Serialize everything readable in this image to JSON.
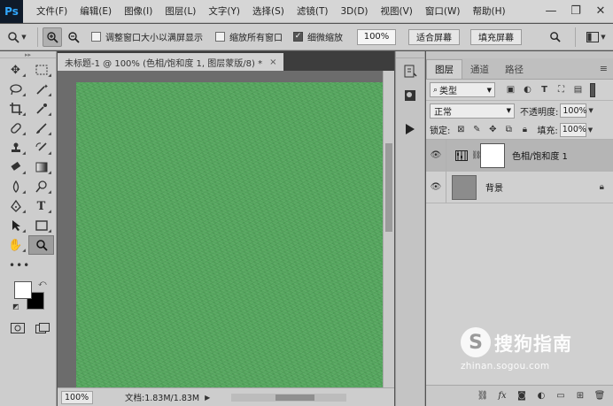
{
  "app": {
    "logo": "Ps"
  },
  "menu": [
    "文件(F)",
    "编辑(E)",
    "图像(I)",
    "图层(L)",
    "文字(Y)",
    "选择(S)",
    "滤镜(T)",
    "3D(D)",
    "视图(V)",
    "窗口(W)",
    "帮助(H)"
  ],
  "window_controls": {
    "minimize": "—",
    "restore": "❐",
    "close": "✕"
  },
  "options": {
    "resize_windows": {
      "label": "调整窗口大小以满屏显示",
      "checked": false
    },
    "zoom_all": {
      "label": "缩放所有窗口",
      "checked": false
    },
    "scrubby_zoom": {
      "label": "细微缩放",
      "checked": true
    },
    "zoom_value": "100%",
    "fit_screen": "适合屏幕",
    "fill_screen": "填充屏幕"
  },
  "document": {
    "tab_title": "未标题-1 @ 100% (色相/饱和度 1, 图层蒙版/8) *",
    "close": "×",
    "zoom": "100%",
    "info": "文档:1.83M/1.83M"
  },
  "layers_panel": {
    "tabs": [
      "图层",
      "通道",
      "路径"
    ],
    "active_tab": 0,
    "filter_kind": "类型",
    "blend_mode": "正常",
    "opacity_label": "不透明度:",
    "opacity_value": "100%",
    "lock_label": "锁定:",
    "fill_label": "填充:",
    "fill_value": "100%",
    "layers": [
      {
        "name": "色相/饱和度 1",
        "selected": true,
        "type": "adjustment"
      },
      {
        "name": "背景",
        "selected": false,
        "type": "background",
        "locked": true
      }
    ]
  },
  "watermark": {
    "logo": "S",
    "text": "搜狗指南",
    "url": "zhinan.sogou.com"
  },
  "colors": {
    "canvas_green": "#56a75f",
    "foreground": "#ffffff",
    "background": "#000000"
  }
}
